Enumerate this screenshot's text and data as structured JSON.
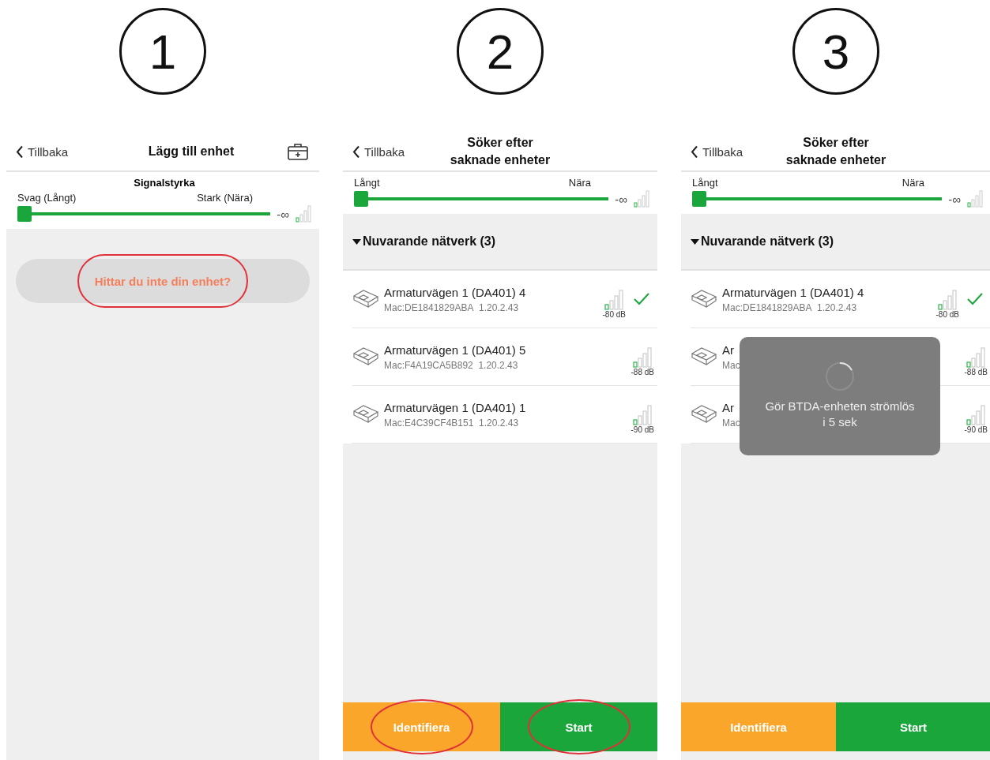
{
  "steps": [
    {
      "number": "1",
      "kind": "add",
      "back": "Tillbaka",
      "title": [
        "Lägg till enhet"
      ],
      "slider": {
        "heading": "Signalstyrka",
        "left_label": "Svag (Långt)",
        "right_label": "Stark (Nära)",
        "level": 0,
        "reading": "-∞"
      },
      "help_button": {
        "label": "Hittar du inte din enhet?",
        "highlighted": true
      }
    },
    {
      "number": "2",
      "kind": "search",
      "back": "Tillbaka",
      "title": [
        "Söker efter",
        "saknade enheter"
      ],
      "slider": {
        "left_label": "Långt",
        "right_label": "Nära",
        "level": 0,
        "reading": "-∞"
      },
      "section": {
        "label": "Nuvarande nätverk (3)",
        "expanded": true
      },
      "devices": [
        {
          "name": "Armaturvägen 1 (DA401) 4",
          "mac": "Mac:DE1841829ABA",
          "version": "1.20.2.43",
          "reading": "-80 dB",
          "selected": true
        },
        {
          "name": "Armaturvägen 1 (DA401) 5",
          "mac": "Mac:F4A19CA5B892",
          "version": "1.20.2.43",
          "reading": "-88 dB",
          "selected": false
        },
        {
          "name": "Armaturvägen 1 (DA401) 1",
          "mac": "Mac:E4C39CF4B151",
          "version": "1.20.2.43",
          "reading": "-90 dB",
          "selected": false
        }
      ],
      "buttons": [
        {
          "label": "Identifiera",
          "kind": "identify",
          "highlighted": true
        },
        {
          "label": "Start",
          "kind": "start",
          "highlighted": true
        }
      ]
    },
    {
      "number": "3",
      "kind": "search",
      "back": "Tillbaka",
      "title": [
        "Söker efter",
        "saknade enheter"
      ],
      "slider": {
        "left_label": "Långt",
        "right_label": "Nära",
        "level": 0,
        "reading": "-∞"
      },
      "section": {
        "label": "Nuvarande nätverk (3)",
        "expanded": true
      },
      "devices": [
        {
          "name": "Armaturvägen 1 (DA401) 4",
          "mac": "Mac:DE1841829ABA",
          "version": "1.20.2.43",
          "reading": "-80 dB",
          "selected": true
        },
        {
          "name": "Ar",
          "mac": "Mac",
          "reading": "-88 dB",
          "selected": false
        },
        {
          "name": "Ar",
          "mac": "Mac",
          "reading": "-90 dB",
          "selected": false
        }
      ],
      "toast": {
        "lines": [
          "Gör BTDA-enheten strömlös",
          "i 5 sek"
        ]
      },
      "buttons": [
        {
          "label": "Identifiera",
          "kind": "identify",
          "highlighted": false
        },
        {
          "label": "Start",
          "kind": "start",
          "highlighted": false
        }
      ]
    }
  ]
}
